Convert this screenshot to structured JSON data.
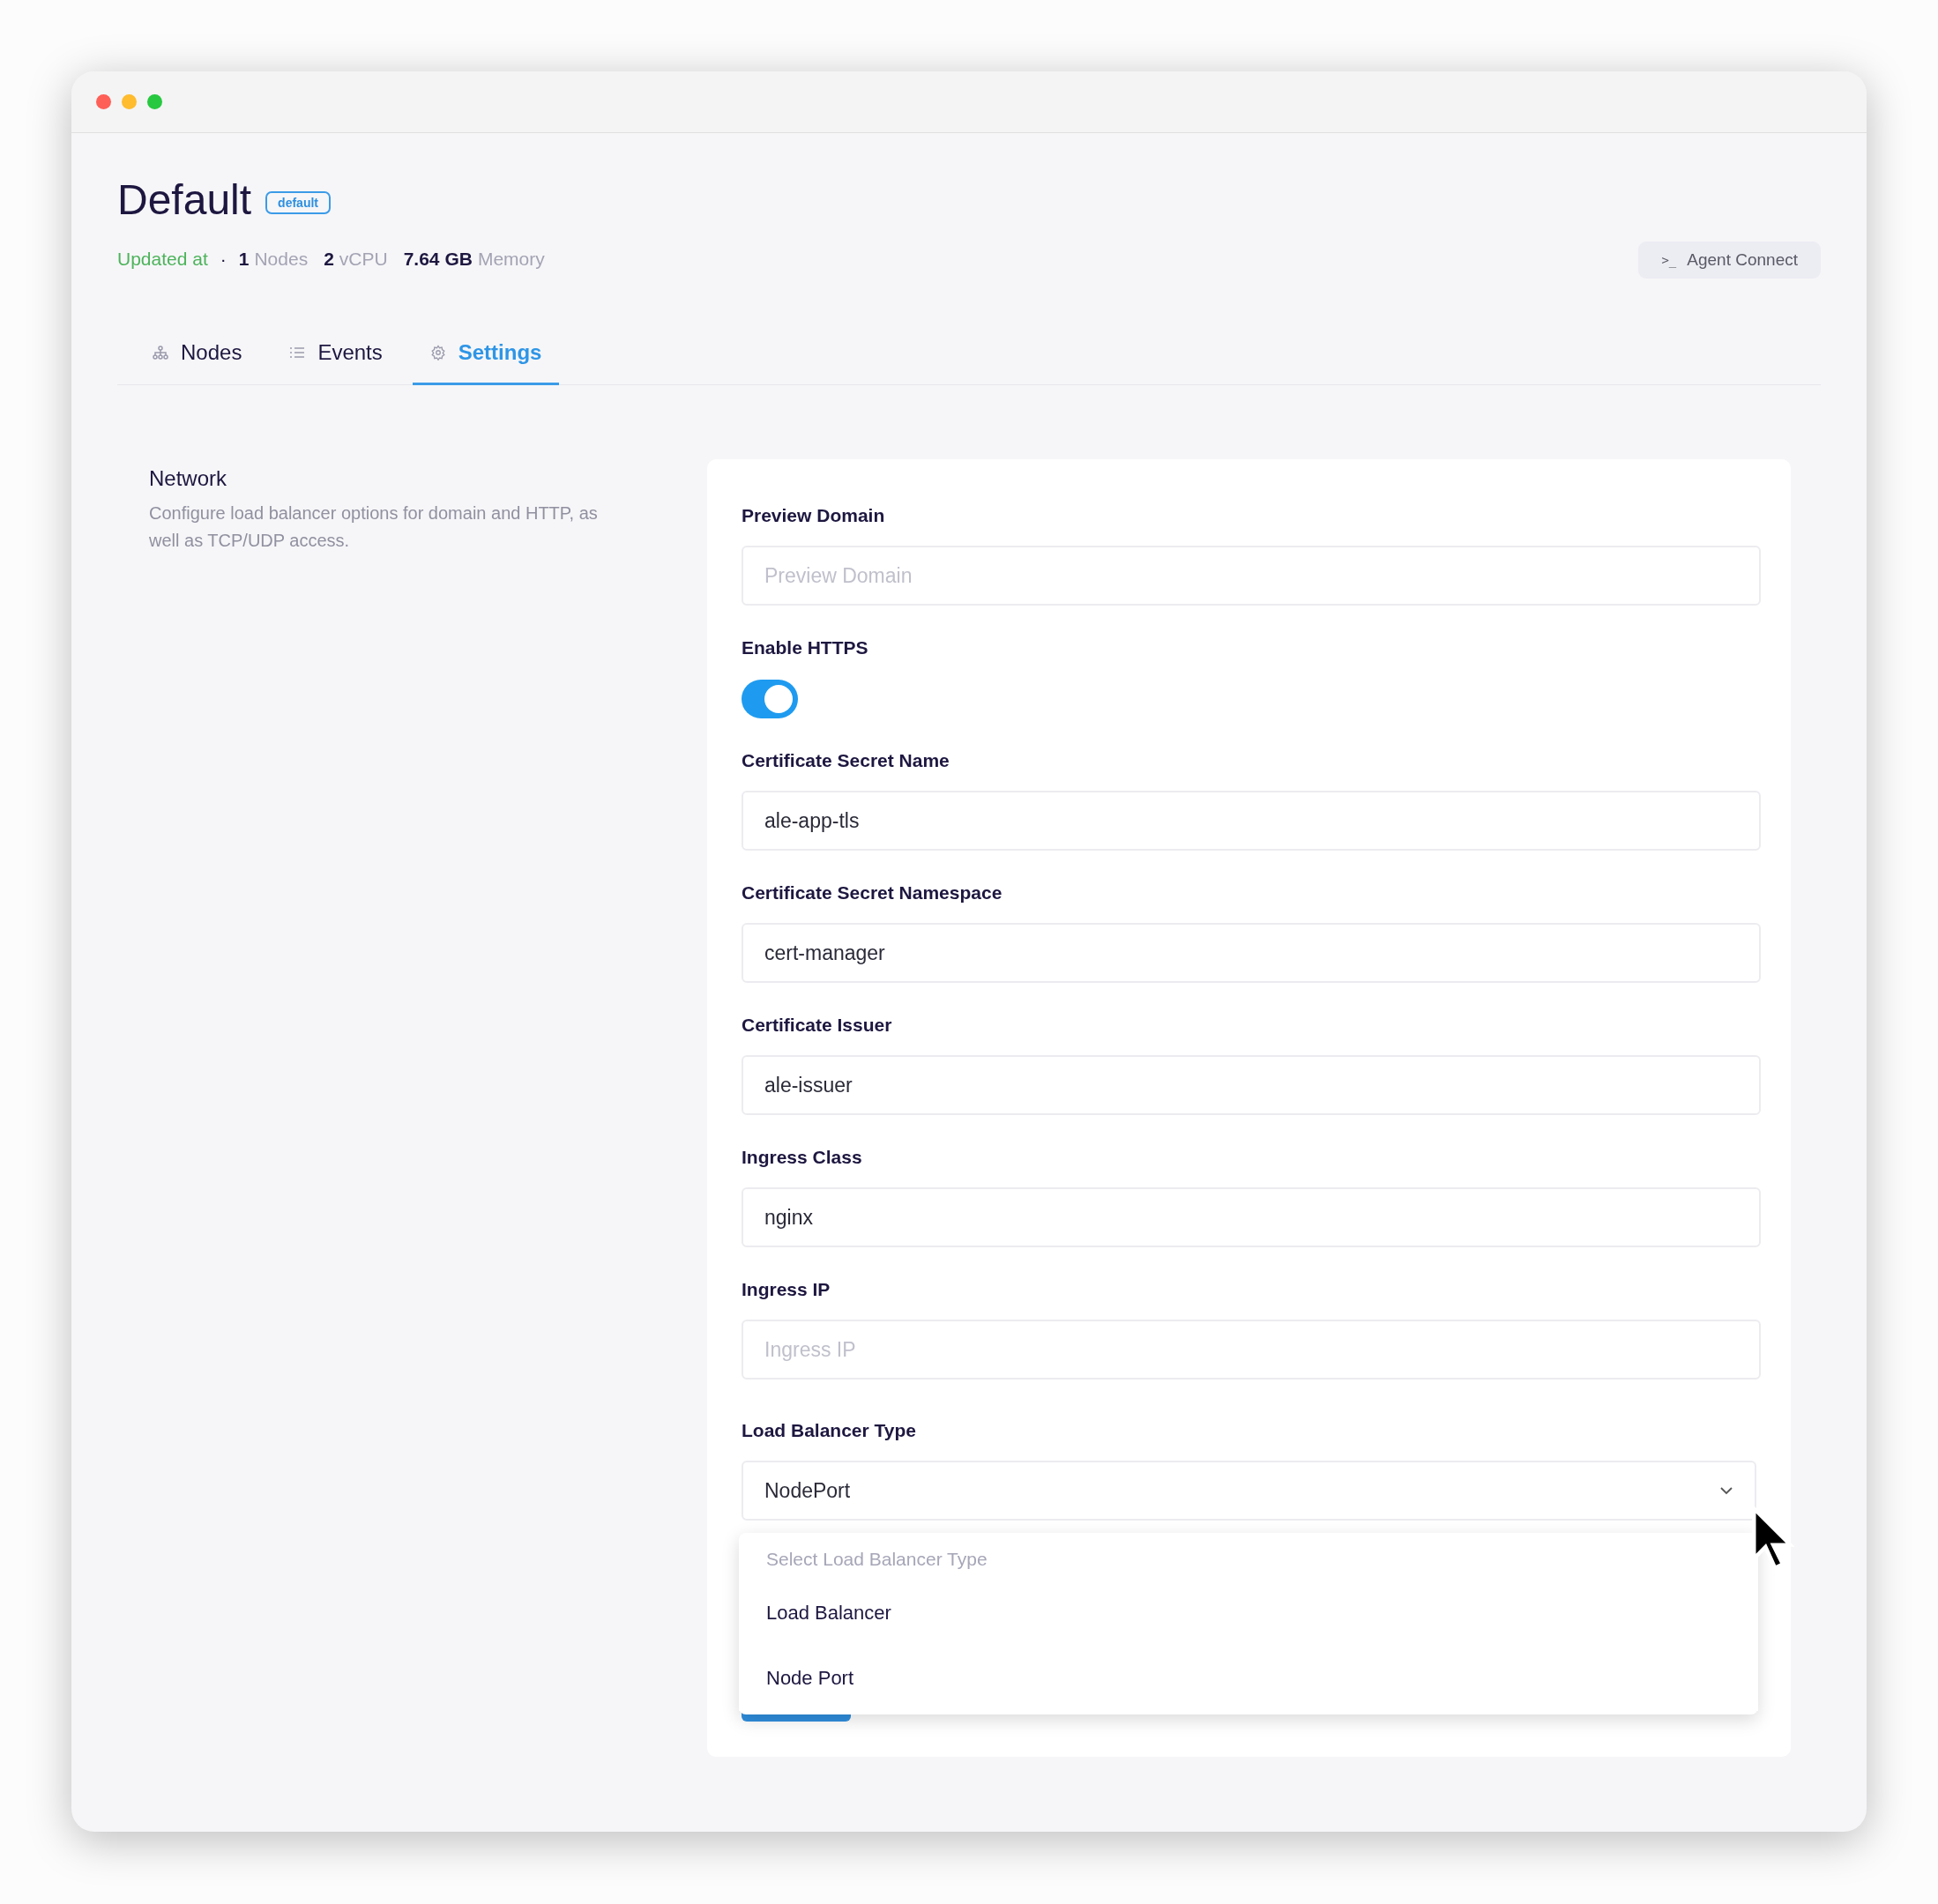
{
  "header": {
    "title": "Default",
    "badge": "default",
    "updated": "Updated at",
    "separator": "·",
    "stats": [
      {
        "value": "1",
        "unit": "Nodes"
      },
      {
        "value": "2",
        "unit": "vCPU"
      },
      {
        "value": "7.64 GB",
        "unit": "Memory"
      }
    ],
    "action": {
      "icon": ">_",
      "label": "Agent Connect"
    }
  },
  "tabs": [
    {
      "label": "Nodes",
      "selected": false
    },
    {
      "label": "Events",
      "selected": false
    },
    {
      "label": "Settings",
      "selected": true
    }
  ],
  "section": {
    "title": "Network",
    "description": "Configure load balancer options for domain and HTTP, as well as TCP/UDP access."
  },
  "fields": [
    {
      "kind": "text",
      "label": "Preview Domain",
      "placeholder": "Preview Domain"
    },
    {
      "kind": "toggle",
      "label": "Enable HTTPS",
      "on": true
    },
    {
      "kind": "text",
      "label": "Certificate Secret Name",
      "value": "ale-app-tls"
    },
    {
      "kind": "text",
      "label": "Certificate Secret Namespace",
      "value": "cert-manager"
    },
    {
      "kind": "text",
      "label": "Certificate Issuer",
      "value": "ale-issuer"
    },
    {
      "kind": "text",
      "label": "Ingress Class",
      "value": "nginx"
    },
    {
      "kind": "text",
      "label": "Ingress IP",
      "placeholder": "Ingress IP"
    },
    {
      "kind": "select",
      "label": "Load Balancer Type",
      "value": "NodePort",
      "expanded": true,
      "menu_placeholder": "Select Load Balancer Type",
      "options": [
        {
          "label": "Load Balancer",
          "selected": false
        },
        {
          "label": "Node Port",
          "selected": false
        }
      ]
    }
  ]
}
